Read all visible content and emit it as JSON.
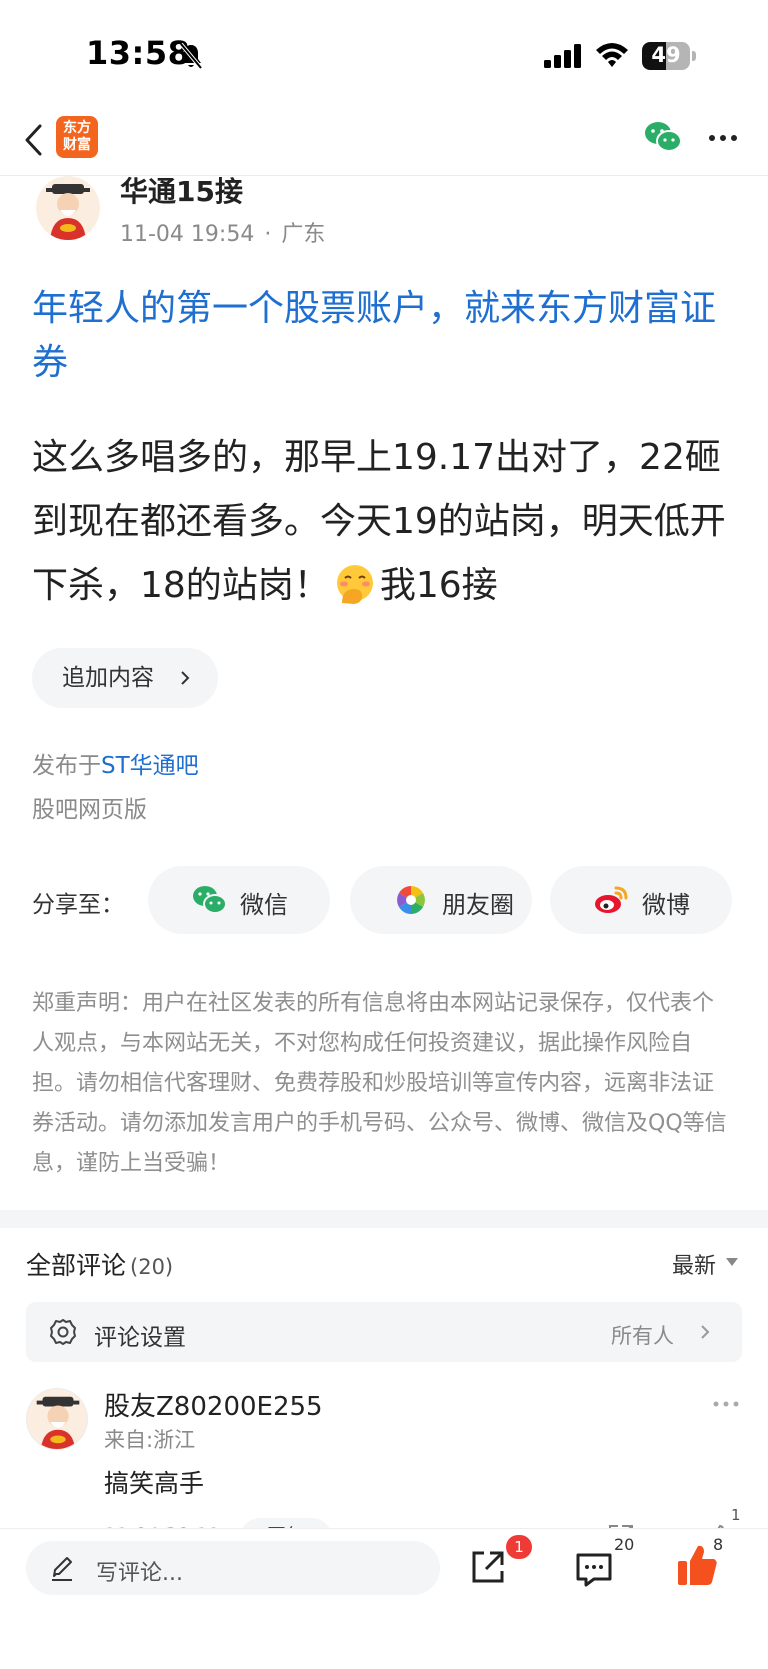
{
  "status_bar": {
    "time": "13:58",
    "battery": "49",
    "battery_level": 0.49
  },
  "nav": {
    "logo_line1": "东方",
    "logo_line2": "财富",
    "icons": [
      "back-icon",
      "wechat-icon",
      "more-icon"
    ]
  },
  "post": {
    "author": "华通15接",
    "date": "11-04 19:54",
    "dot": "·",
    "location": "广东",
    "ad_title": "年轻人的第一个股票账户，就来东方财富证券",
    "body_before_emoji": "这么多唱多的，那早上19.17出对了，22砸到现在都还看多。今天19的站岗，明天低开下杀，18的站岗！",
    "body_after_emoji": "我16接",
    "emoji": "hand-over-mouth-face",
    "append_label": "追加内容",
    "published_prefix": "发布于",
    "forum_name": "ST华通吧",
    "web_version": "股吧网页版"
  },
  "share": {
    "label": "分享至：",
    "wechat": "微信",
    "moments": "朋友圈",
    "weibo": "微博"
  },
  "disclaimer": "郑重声明：用户在社区发表的所有信息将由本网站记录保存，仅代表个人观点，与本网站无关，不对您构成任何投资建议，据此操作风险自担。请勿相信代客理财、免费荐股和炒股培训等宣传内容，远离非法证券活动。请勿添加发言用户的手机号码、公众号、微博、微信及QQ等信息，谨防上当受骗！",
  "comments": {
    "title": "全部评论",
    "count": "(20)",
    "sort": "最新",
    "settings_label": "评论设置",
    "settings_value": "所有人",
    "items": [
      {
        "user": "股友Z80200E255",
        "location": "来自:浙江",
        "text": "搞笑高手",
        "time": "11-04 20:11",
        "reply_label": "回复",
        "like_count": "1"
      }
    ]
  },
  "bottom_bar": {
    "placeholder": "写评论...",
    "share_badge": "1",
    "comment_count": "20",
    "like_count": "8"
  },
  "colors": {
    "link_blue": "#1e6fcf",
    "brand_orange": "#f3641e",
    "badge_red": "#ef3b36",
    "like_orange": "#f4511e",
    "wechat_green": "#2aae67"
  }
}
